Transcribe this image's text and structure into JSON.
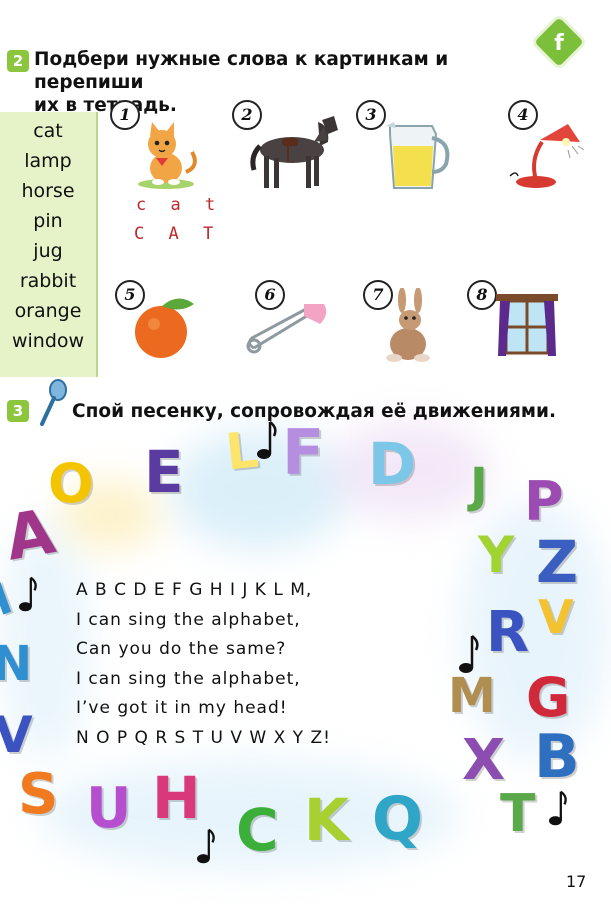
{
  "badge": {
    "letter": "f"
  },
  "task2": {
    "number": "2",
    "line1": "Подбери нужные слова к картинкам и перепиши",
    "line2": "их в тетрадь."
  },
  "word_list": [
    "cat",
    "lamp",
    "horse",
    "pin",
    "jug",
    "rabbit",
    "orange",
    "window"
  ],
  "pictures": [
    {
      "num": "1",
      "icon": "cat-icon"
    },
    {
      "num": "2",
      "icon": "horse-icon"
    },
    {
      "num": "3",
      "icon": "jug-icon"
    },
    {
      "num": "4",
      "icon": "lamp-icon"
    },
    {
      "num": "5",
      "icon": "orange-icon"
    },
    {
      "num": "6",
      "icon": "pin-icon"
    },
    {
      "num": "7",
      "icon": "rabbit-icon"
    },
    {
      "num": "8",
      "icon": "window-icon"
    }
  ],
  "example": {
    "lower": "c a t",
    "upper": "C A T"
  },
  "task3": {
    "number": "3",
    "icon": "microphone-icon",
    "text": "Спой песенку, сопровождая её движениями."
  },
  "song": [
    "A B C D E F G H I J K L M,",
    "I can sing the alphabet,",
    "Can you do the same?",
    "I can sing the alphabet,",
    "I’ve got it in my head!",
    "N O P Q R S T U V W X Y Z!"
  ],
  "letters": {
    "O": "O",
    "E": "E",
    "L": "L",
    "F": "F",
    "D": "D",
    "J": "J",
    "P": "P",
    "A": "A",
    "I": "I",
    "Y": "Y",
    "Z": "Z",
    "N": "N",
    "R": "R",
    "V": "V",
    "M": "M",
    "G": "G",
    "W": "V",
    "X": "X",
    "B": "B",
    "S": "S",
    "U": "U",
    "H": "H",
    "C": "C",
    "K": "K",
    "Q": "Q",
    "T": "T"
  },
  "colors": {
    "green_label": "#8cc63f",
    "word_box": "#e6f3c9",
    "example_red": "#c0272d"
  },
  "page_number": "17"
}
